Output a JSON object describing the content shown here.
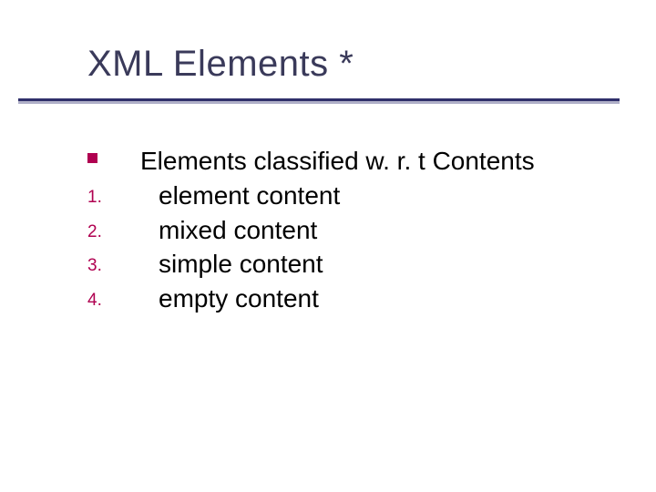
{
  "title": "XML Elements *",
  "body": {
    "heading": "Elements classified w. r. t Contents",
    "items": [
      {
        "marker": "1.",
        "text": "element content"
      },
      {
        "marker": "2.",
        "text": "mixed content"
      },
      {
        "marker": "3.",
        "text": "simple content"
      },
      {
        "marker": "4.",
        "text": "empty content"
      }
    ]
  }
}
